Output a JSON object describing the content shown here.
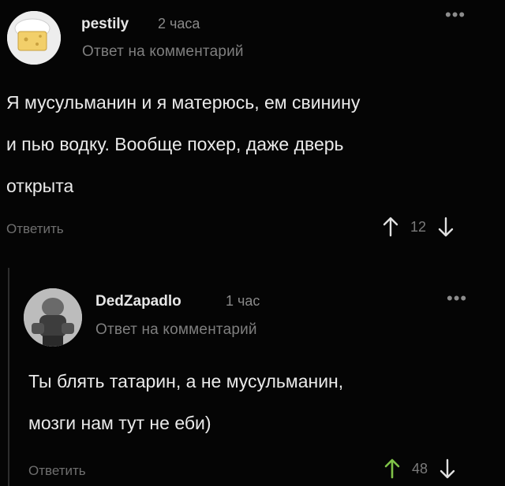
{
  "comments": [
    {
      "author": "pestily",
      "time": "2 часа",
      "reply_to": "Ответ на комментарий",
      "lines": [
        "Я мусульманин и я матерюсь, ем свинину",
        "и пью водку. Вообще похер, даже дверь",
        "открыта"
      ],
      "reply_label": "Ответить",
      "score": "12",
      "more": "•••",
      "upvote_color": "#e0e0e0"
    },
    {
      "author": "DedZapadlo",
      "time": "1 час",
      "reply_to": "Ответ на комментарий",
      "lines": [
        "Ты блять татарин, а не мусульманин,",
        "мозги нам тут не еби)"
      ],
      "reply_label": "Ответить",
      "score": "48",
      "more": "•••",
      "upvote_color": "#7fc248"
    }
  ],
  "icons": [
    "avatar-chef-icon",
    "avatar-photo-icon",
    "more-options-icon",
    "upvote-arrow-icon",
    "downvote-arrow-icon"
  ]
}
